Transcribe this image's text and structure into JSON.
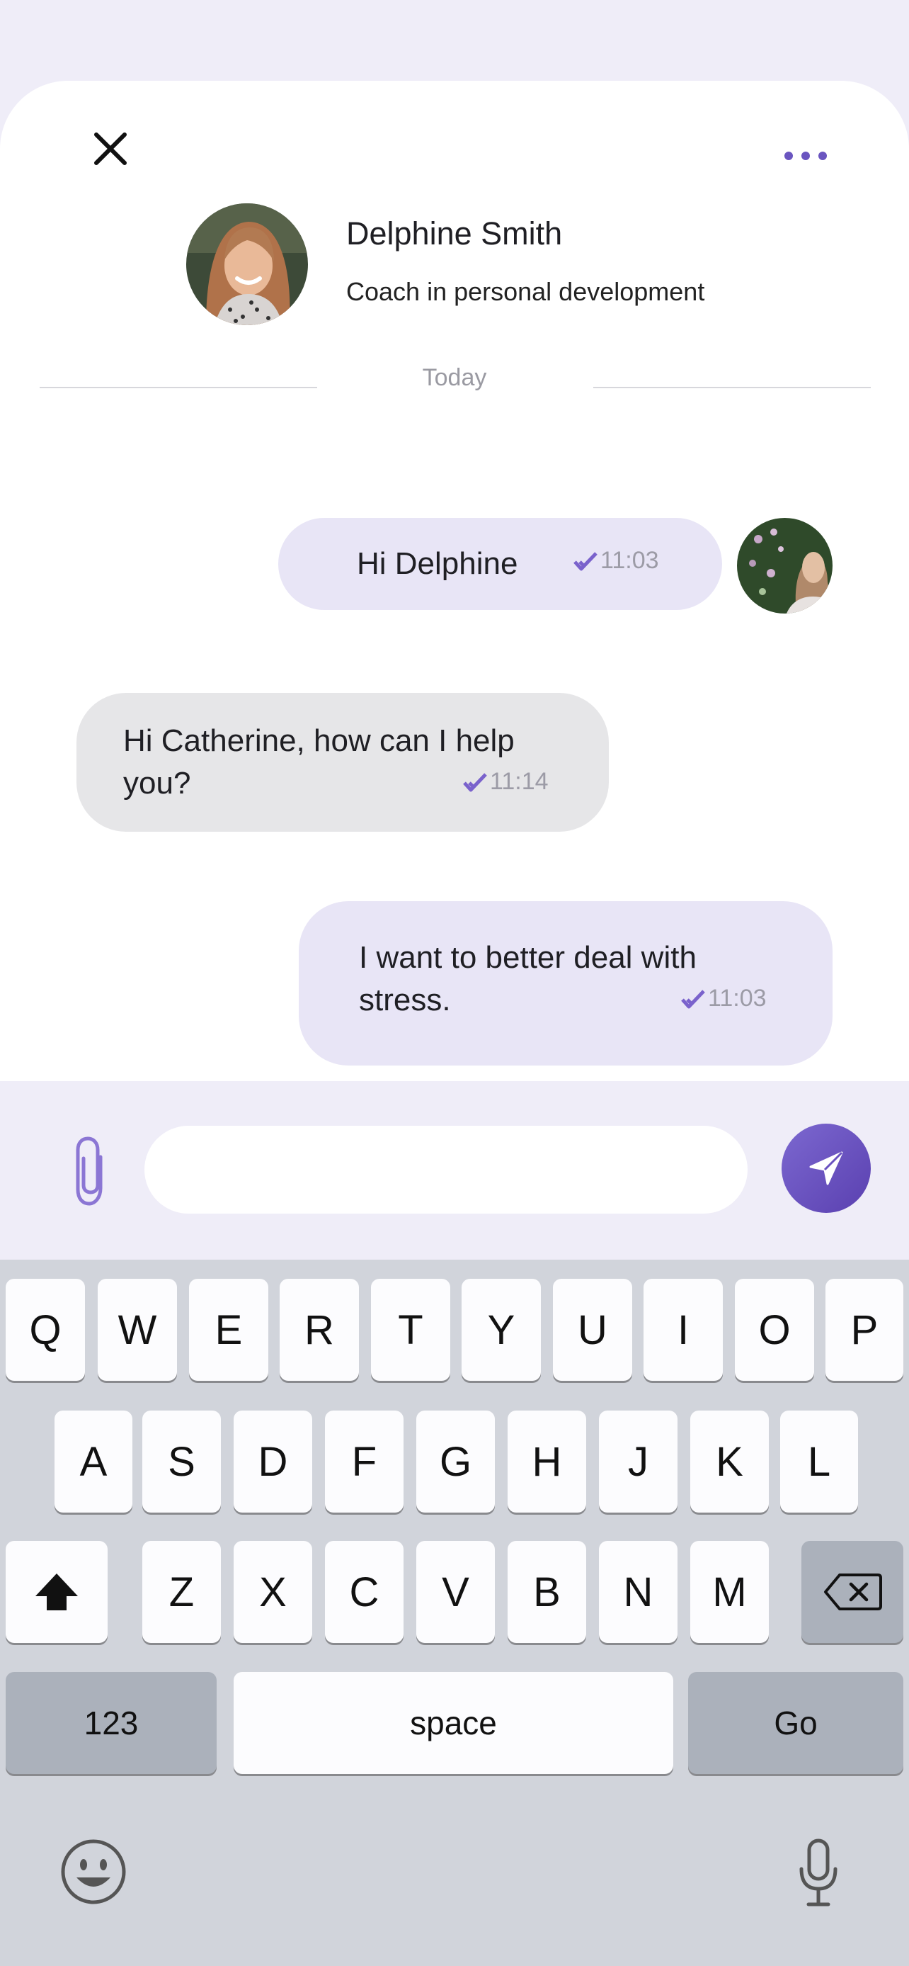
{
  "header": {
    "close_icon": "close-icon",
    "more_icon": "more-horizontal-icon",
    "coach_name": "Delphine Smith",
    "coach_title": "Coach in personal development"
  },
  "date_separator": "Today",
  "messages": [
    {
      "direction": "outgoing",
      "text": "Hi Delphine",
      "time": "11:03",
      "status": "read"
    },
    {
      "direction": "incoming",
      "text": "Hi Catherine, how can I help you?",
      "line1": "Hi Catherine, how can I help",
      "line2": "you?",
      "time": "11:14",
      "status": "read"
    },
    {
      "direction": "outgoing",
      "text": "I want to better deal with stress.",
      "line1": "I want to better deal with",
      "line2": "stress.",
      "time": "11:03",
      "status": "read"
    }
  ],
  "composer": {
    "input_value": "",
    "attach_icon": "paperclip-icon",
    "send_icon": "send-icon"
  },
  "keyboard": {
    "row1": [
      "Q",
      "W",
      "E",
      "R",
      "T",
      "Y",
      "U",
      "I",
      "O",
      "P"
    ],
    "row2": [
      "A",
      "S",
      "D",
      "F",
      "G",
      "H",
      "J",
      "K",
      "L"
    ],
    "row3": [
      "Z",
      "X",
      "C",
      "V",
      "B",
      "N",
      "M"
    ],
    "numbers_label": "123",
    "space_label": "space",
    "go_label": "Go",
    "shift_icon": "shift-icon",
    "backspace_icon": "backspace-icon",
    "emoji_icon": "emoji-icon",
    "mic_icon": "microphone-icon"
  },
  "colors": {
    "accent": "#6a55c0",
    "outgoing_bubble": "#e8e5f6",
    "incoming_bubble": "#e6e6e8",
    "background": "#efedf8"
  }
}
